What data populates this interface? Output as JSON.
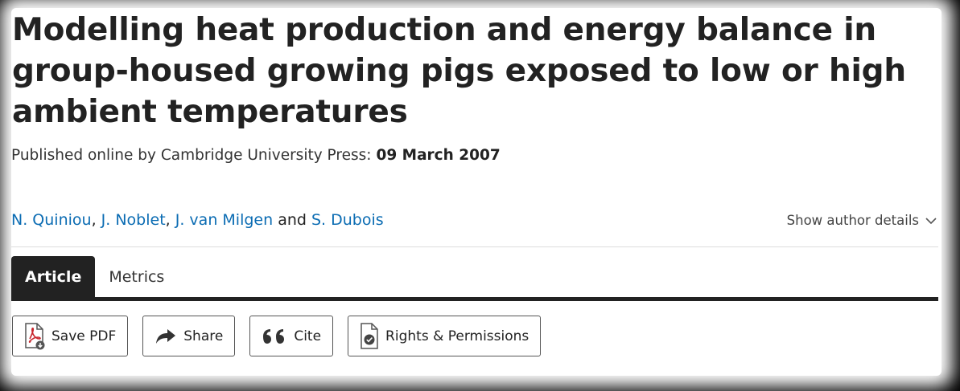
{
  "article": {
    "title": "Modelling heat production and energy balance in group-housed growing pigs exposed to low or high ambient temperatures",
    "published_prefix": "Published online by Cambridge University Press:",
    "published_date": "09 March 2007"
  },
  "authors": {
    "list": [
      "N. Quiniou",
      "J. Noblet",
      "J. van Milgen",
      "S. Dubois"
    ],
    "sep1": ", ",
    "sep2": ", ",
    "conj": " and ",
    "show_details_label": "Show author details"
  },
  "tabs": [
    {
      "label": "Article",
      "active": true
    },
    {
      "label": "Metrics",
      "active": false
    }
  ],
  "actions": {
    "save_pdf": "Save PDF",
    "share": "Share",
    "cite": "Cite",
    "rights": "Rights & Permissions"
  },
  "colors": {
    "link": "#0b6cb3",
    "tab_active_bg": "#222222",
    "pdf_red": "#c8252c"
  }
}
